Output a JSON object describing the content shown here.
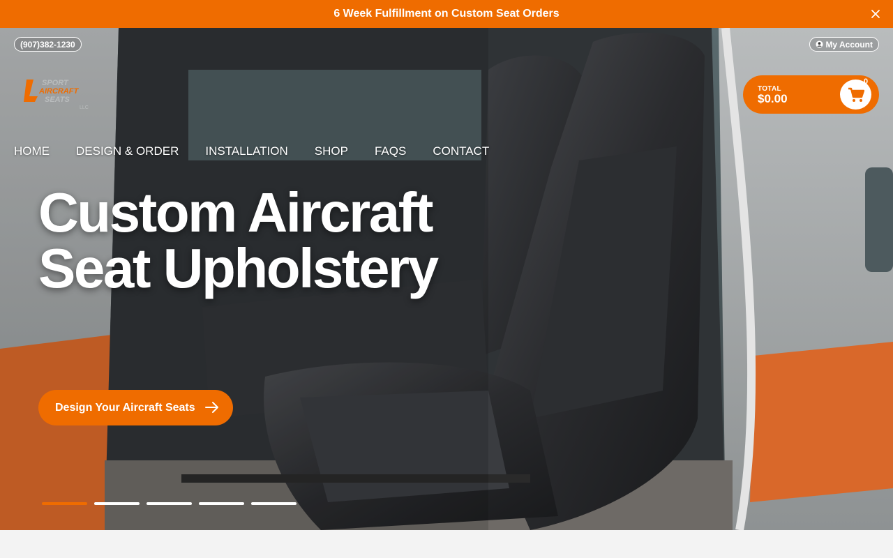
{
  "announcement": {
    "text": "6 Week Fulfillment on Custom Seat Orders",
    "close_icon": "close-icon"
  },
  "topbar": {
    "phone": "(907)382-1230",
    "account_label": "My Account",
    "account_icon": "user-circle-icon"
  },
  "logo": {
    "line1": "SPORT",
    "line2": "AIRCRAFT",
    "line3": "SEATS",
    "line4": "LLC"
  },
  "cart": {
    "label": "TOTAL",
    "amount": "$0.00",
    "count": "0",
    "icon": "cart-icon"
  },
  "nav": {
    "items": [
      "HOME",
      "DESIGN & ORDER",
      "INSTALLATION",
      "SHOP",
      "FAQS",
      "CONTACT"
    ]
  },
  "hero": {
    "headline_line1": "Custom Aircraft",
    "headline_line2": "Seat Upholstery",
    "cta_label": "Design Your Aircraft Seats",
    "cta_icon": "arrow-right-icon",
    "slides_total": 5,
    "slide_active": 1
  },
  "colors": {
    "accent": "#ef6c00",
    "text_light": "#ffffff"
  }
}
